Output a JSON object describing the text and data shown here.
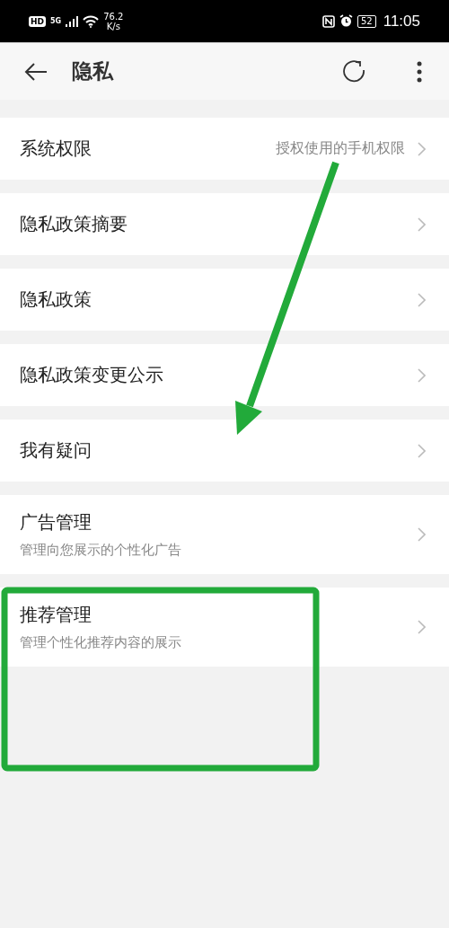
{
  "status_bar": {
    "hd": "HD",
    "network": "5G",
    "speed": "76.2",
    "speed_unit": "K/s",
    "battery": "52",
    "time": "11:05"
  },
  "header": {
    "title": "隐私"
  },
  "items": [
    {
      "title": "系统权限",
      "detail": "授权使用的手机权限"
    },
    {
      "title": "隐私政策摘要"
    },
    {
      "title": "隐私政策"
    },
    {
      "title": "隐私政策变更公示"
    },
    {
      "title": "我有疑问"
    },
    {
      "title": "广告管理",
      "subtitle": "管理向您展示的个性化广告"
    },
    {
      "title": "推荐管理",
      "subtitle": "管理个性化推荐内容的展示"
    }
  ]
}
